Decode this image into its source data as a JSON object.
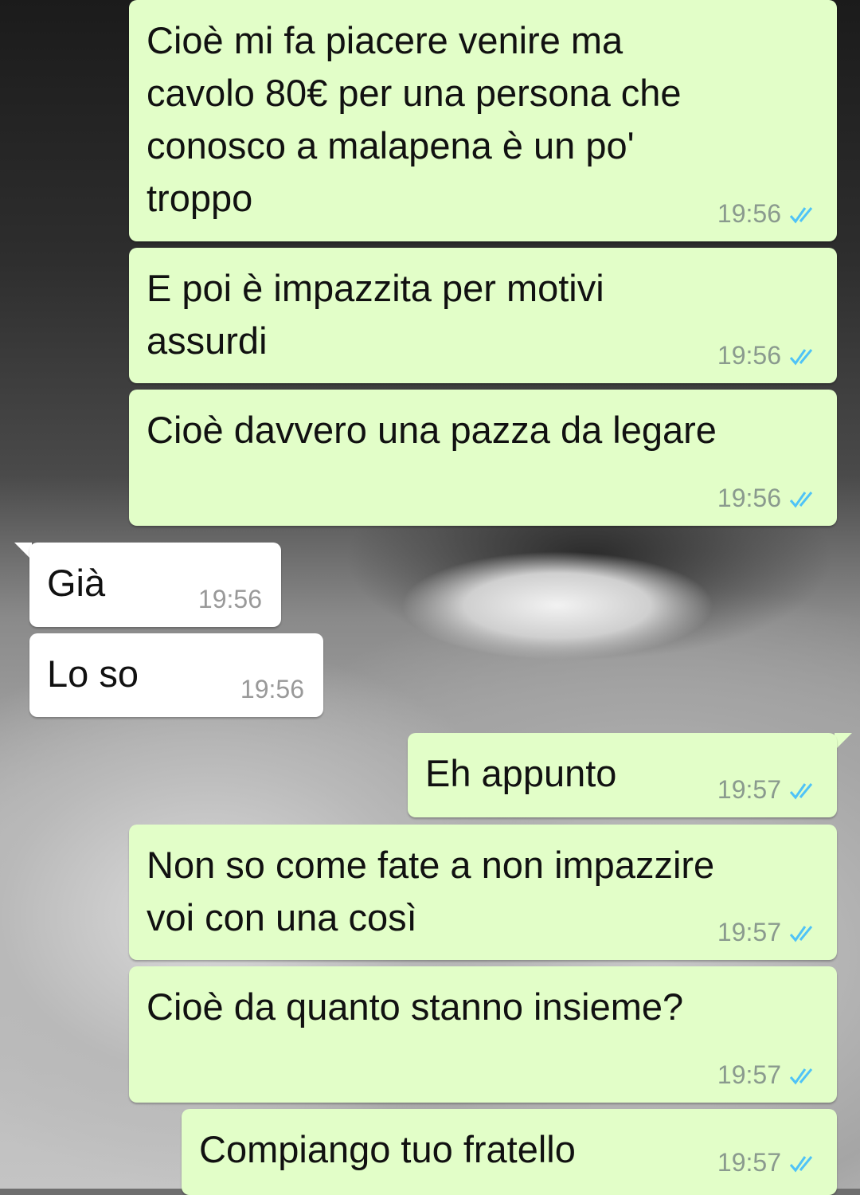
{
  "colors": {
    "outgoing_bubble": "#e2fec8",
    "incoming_bubble": "#ffffff",
    "read_ticks": "#4fc3f7"
  },
  "messages": [
    {
      "dir": "out",
      "text": "Cioè mi fa piacere venire ma\ncavolo 80€ per una persona che\nconosco a malapena è un po'\ntroppo",
      "time": "19:56",
      "status": "read-ticks-icon"
    },
    {
      "dir": "out",
      "text": "E poi è impazzita per motivi\nassurdi",
      "time": "19:56",
      "status": "read-ticks-icon"
    },
    {
      "dir": "out",
      "text": "Cioè davvero una pazza da legare",
      "time": "19:56",
      "status": "read-ticks-icon"
    },
    {
      "dir": "in",
      "text": "Già",
      "time": "19:56"
    },
    {
      "dir": "in",
      "text": "Lo so",
      "time": "19:56"
    },
    {
      "dir": "out",
      "text": "Eh appunto",
      "time": "19:57",
      "status": "read-ticks-icon"
    },
    {
      "dir": "out",
      "text": "Non so come fate a non impazzire\nvoi con una così",
      "time": "19:57",
      "status": "read-ticks-icon"
    },
    {
      "dir": "out",
      "text": "Cioè da quanto stanno insieme?",
      "time": "19:57",
      "status": "read-ticks-icon"
    },
    {
      "dir": "out",
      "text": "Compiango tuo fratello",
      "time": "19:57",
      "status": "read-ticks-icon"
    }
  ]
}
